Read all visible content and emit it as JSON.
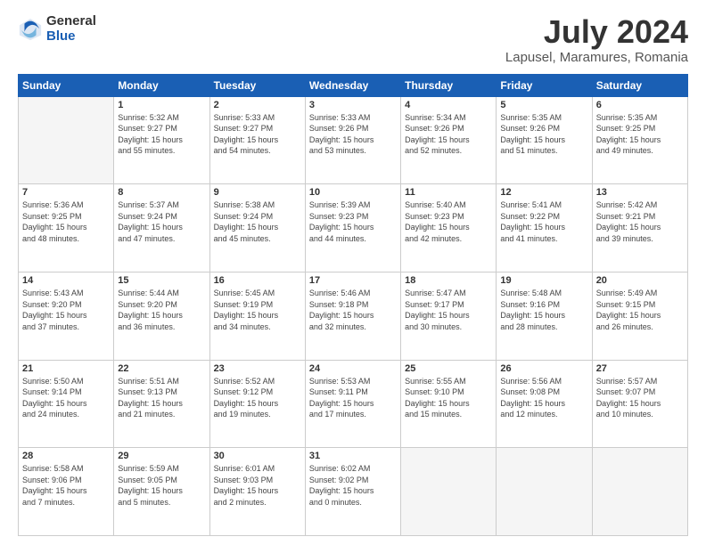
{
  "header": {
    "logo_general": "General",
    "logo_blue": "Blue",
    "main_title": "July 2024",
    "subtitle": "Lapusel, Maramures, Romania"
  },
  "calendar": {
    "weekdays": [
      "Sunday",
      "Monday",
      "Tuesday",
      "Wednesday",
      "Thursday",
      "Friday",
      "Saturday"
    ],
    "weeks": [
      [
        {
          "day": "",
          "sunrise": "",
          "sunset": "",
          "daylight": ""
        },
        {
          "day": "1",
          "sunrise": "Sunrise: 5:32 AM",
          "sunset": "Sunset: 9:27 PM",
          "daylight": "Daylight: 15 hours and 55 minutes."
        },
        {
          "day": "2",
          "sunrise": "Sunrise: 5:33 AM",
          "sunset": "Sunset: 9:27 PM",
          "daylight": "Daylight: 15 hours and 54 minutes."
        },
        {
          "day": "3",
          "sunrise": "Sunrise: 5:33 AM",
          "sunset": "Sunset: 9:26 PM",
          "daylight": "Daylight: 15 hours and 53 minutes."
        },
        {
          "day": "4",
          "sunrise": "Sunrise: 5:34 AM",
          "sunset": "Sunset: 9:26 PM",
          "daylight": "Daylight: 15 hours and 52 minutes."
        },
        {
          "day": "5",
          "sunrise": "Sunrise: 5:35 AM",
          "sunset": "Sunset: 9:26 PM",
          "daylight": "Daylight: 15 hours and 51 minutes."
        },
        {
          "day": "6",
          "sunrise": "Sunrise: 5:35 AM",
          "sunset": "Sunset: 9:25 PM",
          "daylight": "Daylight: 15 hours and 49 minutes."
        }
      ],
      [
        {
          "day": "7",
          "sunrise": "Sunrise: 5:36 AM",
          "sunset": "Sunset: 9:25 PM",
          "daylight": "Daylight: 15 hours and 48 minutes."
        },
        {
          "day": "8",
          "sunrise": "Sunrise: 5:37 AM",
          "sunset": "Sunset: 9:24 PM",
          "daylight": "Daylight: 15 hours and 47 minutes."
        },
        {
          "day": "9",
          "sunrise": "Sunrise: 5:38 AM",
          "sunset": "Sunset: 9:24 PM",
          "daylight": "Daylight: 15 hours and 45 minutes."
        },
        {
          "day": "10",
          "sunrise": "Sunrise: 5:39 AM",
          "sunset": "Sunset: 9:23 PM",
          "daylight": "Daylight: 15 hours and 44 minutes."
        },
        {
          "day": "11",
          "sunrise": "Sunrise: 5:40 AM",
          "sunset": "Sunset: 9:23 PM",
          "daylight": "Daylight: 15 hours and 42 minutes."
        },
        {
          "day": "12",
          "sunrise": "Sunrise: 5:41 AM",
          "sunset": "Sunset: 9:22 PM",
          "daylight": "Daylight: 15 hours and 41 minutes."
        },
        {
          "day": "13",
          "sunrise": "Sunrise: 5:42 AM",
          "sunset": "Sunset: 9:21 PM",
          "daylight": "Daylight: 15 hours and 39 minutes."
        }
      ],
      [
        {
          "day": "14",
          "sunrise": "Sunrise: 5:43 AM",
          "sunset": "Sunset: 9:20 PM",
          "daylight": "Daylight: 15 hours and 37 minutes."
        },
        {
          "day": "15",
          "sunrise": "Sunrise: 5:44 AM",
          "sunset": "Sunset: 9:20 PM",
          "daylight": "Daylight: 15 hours and 36 minutes."
        },
        {
          "day": "16",
          "sunrise": "Sunrise: 5:45 AM",
          "sunset": "Sunset: 9:19 PM",
          "daylight": "Daylight: 15 hours and 34 minutes."
        },
        {
          "day": "17",
          "sunrise": "Sunrise: 5:46 AM",
          "sunset": "Sunset: 9:18 PM",
          "daylight": "Daylight: 15 hours and 32 minutes."
        },
        {
          "day": "18",
          "sunrise": "Sunrise: 5:47 AM",
          "sunset": "Sunset: 9:17 PM",
          "daylight": "Daylight: 15 hours and 30 minutes."
        },
        {
          "day": "19",
          "sunrise": "Sunrise: 5:48 AM",
          "sunset": "Sunset: 9:16 PM",
          "daylight": "Daylight: 15 hours and 28 minutes."
        },
        {
          "day": "20",
          "sunrise": "Sunrise: 5:49 AM",
          "sunset": "Sunset: 9:15 PM",
          "daylight": "Daylight: 15 hours and 26 minutes."
        }
      ],
      [
        {
          "day": "21",
          "sunrise": "Sunrise: 5:50 AM",
          "sunset": "Sunset: 9:14 PM",
          "daylight": "Daylight: 15 hours and 24 minutes."
        },
        {
          "day": "22",
          "sunrise": "Sunrise: 5:51 AM",
          "sunset": "Sunset: 9:13 PM",
          "daylight": "Daylight: 15 hours and 21 minutes."
        },
        {
          "day": "23",
          "sunrise": "Sunrise: 5:52 AM",
          "sunset": "Sunset: 9:12 PM",
          "daylight": "Daylight: 15 hours and 19 minutes."
        },
        {
          "day": "24",
          "sunrise": "Sunrise: 5:53 AM",
          "sunset": "Sunset: 9:11 PM",
          "daylight": "Daylight: 15 hours and 17 minutes."
        },
        {
          "day": "25",
          "sunrise": "Sunrise: 5:55 AM",
          "sunset": "Sunset: 9:10 PM",
          "daylight": "Daylight: 15 hours and 15 minutes."
        },
        {
          "day": "26",
          "sunrise": "Sunrise: 5:56 AM",
          "sunset": "Sunset: 9:08 PM",
          "daylight": "Daylight: 15 hours and 12 minutes."
        },
        {
          "day": "27",
          "sunrise": "Sunrise: 5:57 AM",
          "sunset": "Sunset: 9:07 PM",
          "daylight": "Daylight: 15 hours and 10 minutes."
        }
      ],
      [
        {
          "day": "28",
          "sunrise": "Sunrise: 5:58 AM",
          "sunset": "Sunset: 9:06 PM",
          "daylight": "Daylight: 15 hours and 7 minutes."
        },
        {
          "day": "29",
          "sunrise": "Sunrise: 5:59 AM",
          "sunset": "Sunset: 9:05 PM",
          "daylight": "Daylight: 15 hours and 5 minutes."
        },
        {
          "day": "30",
          "sunrise": "Sunrise: 6:01 AM",
          "sunset": "Sunset: 9:03 PM",
          "daylight": "Daylight: 15 hours and 2 minutes."
        },
        {
          "day": "31",
          "sunrise": "Sunrise: 6:02 AM",
          "sunset": "Sunset: 9:02 PM",
          "daylight": "Daylight: 15 hours and 0 minutes."
        },
        {
          "day": "",
          "sunrise": "",
          "sunset": "",
          "daylight": ""
        },
        {
          "day": "",
          "sunrise": "",
          "sunset": "",
          "daylight": ""
        },
        {
          "day": "",
          "sunrise": "",
          "sunset": "",
          "daylight": ""
        }
      ]
    ]
  }
}
